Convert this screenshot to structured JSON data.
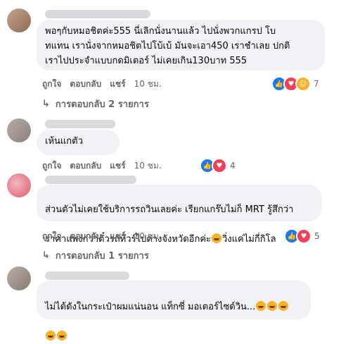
{
  "comments": [
    {
      "text": "พอๆกับหมอชิตค่ะ555 นี่เลิกนั่งนานแล้ว ไปนั่งพวกแกรป โบ\nทแทน เรานั่งจากหมอชิตไปโบ้เบ้ มันจะเอา450 เราชำเลย ปกติ\nเราไปประจำแบบกดมิเตอร์ ไม่เคยเกิน130บาท 555",
      "actions": {
        "like": "ถูกใจ",
        "reply": "ตอบกลับ",
        "share": "แชร์",
        "time": "10 ชม."
      },
      "reactions": {
        "icons": [
          "like-icon",
          "love-icon",
          "haha-icon"
        ],
        "count": "7"
      },
      "replies": "การตอบกลับ 2 รายการ"
    },
    {
      "text": "เห้นแกตัว",
      "actions": {
        "like": "ถูกใจ",
        "reply": "ตอบกลับ",
        "share": "แชร์",
        "time": "10 ชม."
      },
      "reactions": {
        "icons": [
          "like-icon",
          "love-icon"
        ],
        "count": "4"
      }
    },
    {
      "text_line1": "ส่วนตัวไม่เคยใช้บริการรถวินเลยค่ะ เรียกแกร๊บไม่ก็ MRT รู้สึกว่า",
      "text_line2a": "ราคาแพงกว่าตั๋วรถทัวร์ไปต่างจังหวัดอีกค่ะ",
      "text_line2b": "วิ่งแค่ไม่กี่กิโล",
      "actions": {
        "like": "ถูกใจ",
        "reply": "ตอบกลับ",
        "share": "แชร์",
        "time": "10 ชม."
      },
      "reactions": {
        "icons": [
          "like-icon",
          "love-icon"
        ],
        "count": "5"
      },
      "replies": "การตอบกลับ 1 รายการ"
    },
    {
      "text": "ไม่ได้ดังในกระเป๋าผมแน่นอน แท็กซี่ มอเตอร์ไซด์วิน..."
    }
  ],
  "colors": {
    "bubble": "#f0f2f5",
    "like": "#1877f2",
    "love": "#f33e58",
    "haha": "#f7b125",
    "meta": "#65676b"
  }
}
